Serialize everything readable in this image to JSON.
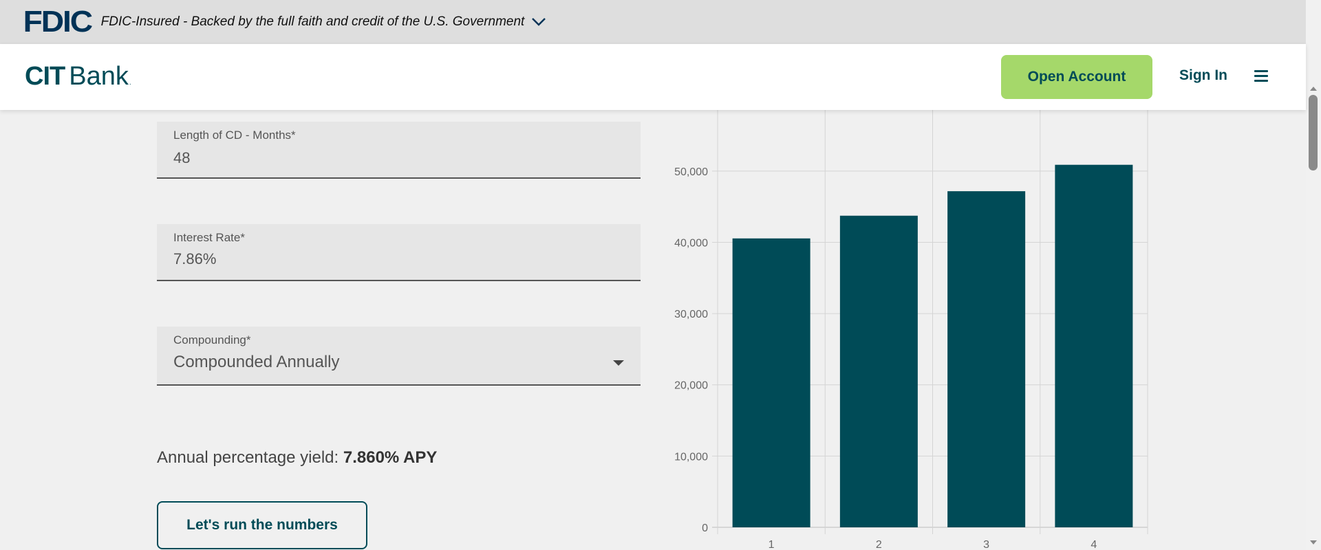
{
  "fdic": {
    "logo_text": "FDIC",
    "banner_text": "FDIC-Insured - Backed by the full faith and credit of the U.S. Government",
    "expand_icon": "chevron-down-icon"
  },
  "header": {
    "logo": {
      "cit": "CIT",
      "bank": "Bank",
      "reg": "."
    },
    "open_account": "Open Account",
    "sign_in": "Sign In",
    "menu_icon": "hamburger-menu-icon"
  },
  "form": {
    "length": {
      "label": "Length of CD - Months*",
      "value": "48"
    },
    "rate": {
      "label": "Interest Rate*",
      "value": "7.86%"
    },
    "compounding": {
      "label": "Compounding*",
      "value": "Compounded Annually"
    },
    "apy_prefix": "Annual percentage yield: ",
    "apy_value": "7.860% APY",
    "run_button": "Let's run the numbers"
  },
  "chart_data": {
    "type": "bar",
    "categories": [
      "1",
      "2",
      "3",
      "4"
    ],
    "values": [
      40550,
      43737,
      47175,
      50883
    ],
    "yticks": [
      "0",
      "10,000",
      "20,000",
      "30,000",
      "40,000",
      "50,000"
    ],
    "ylim": [
      0,
      59000
    ],
    "grid": true,
    "bar_color": "#004b57"
  },
  "colors": {
    "brand": "#004b57",
    "accent": "#a5d86a",
    "fdic": "#003256"
  }
}
